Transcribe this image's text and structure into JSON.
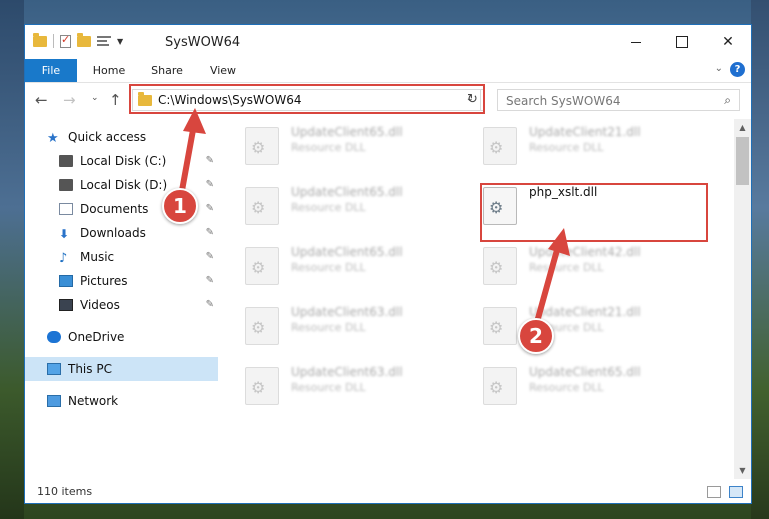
{
  "window": {
    "title": "SysWOW64",
    "minimize_icon": "minimize-icon",
    "maximize_icon": "maximize-icon",
    "close_symbol": "✕"
  },
  "ribbon": {
    "tabs": [
      "File",
      "Home",
      "Share",
      "View"
    ],
    "help_symbol": "?",
    "expand_symbol": "⌄"
  },
  "nav": {
    "back_symbol": "←",
    "forward_symbol": "→",
    "recent_symbol": "⌄",
    "up_symbol": "↑",
    "address": "C:\\Windows\\SysWOW64",
    "address_drop": "⌄",
    "refresh_symbol": "↻",
    "search_placeholder": "Search SysWOW64",
    "search_symbol": "⌕"
  },
  "sidebar": {
    "items": [
      {
        "label": "Quick access",
        "icon": "star-icon",
        "pinned": false
      },
      {
        "label": "Local Disk (C:)",
        "icon": "disk-icon",
        "pinned": true
      },
      {
        "label": "Local Disk (D:)",
        "icon": "disk-icon",
        "pinned": true
      },
      {
        "label": "Documents",
        "icon": "documents-icon",
        "pinned": true
      },
      {
        "label": "Downloads",
        "icon": "download-icon",
        "pinned": true
      },
      {
        "label": "Music",
        "icon": "music-icon",
        "pinned": true
      },
      {
        "label": "Pictures",
        "icon": "pictures-icon",
        "pinned": true
      },
      {
        "label": "Videos",
        "icon": "videos-icon",
        "pinned": true
      },
      {
        "label": "OneDrive",
        "icon": "cloud-icon",
        "pinned": false
      },
      {
        "label": "This PC",
        "icon": "computer-icon",
        "pinned": false,
        "selected": true
      },
      {
        "label": "Network",
        "icon": "network-icon",
        "pinned": false
      }
    ],
    "pin_symbol": "📌"
  },
  "files": [
    {
      "name": "UpdateClient65.dll",
      "type": "Resource DLL",
      "blurred": true
    },
    {
      "name": "UpdateClient21.dll",
      "type": "Resource DLL",
      "blurred": true
    },
    {
      "name": "UpdateClient65.dll",
      "type": "Resource DLL",
      "blurred": true
    },
    {
      "name": "php_xslt.dll",
      "type": "",
      "blurred": false
    },
    {
      "name": "UpdateClient65.dll",
      "type": "Resource DLL",
      "blurred": true
    },
    {
      "name": "UpdateClient42.dll",
      "type": "Resource DLL",
      "blurred": true
    },
    {
      "name": "UpdateClient63.dll",
      "type": "Resource DLL",
      "blurred": true
    },
    {
      "name": "UpdateClient21.dll",
      "type": "Resource DLL",
      "blurred": true
    },
    {
      "name": "UpdateClient63.dll",
      "type": "Resource DLL",
      "blurred": true
    },
    {
      "name": "UpdateClient65.dll",
      "type": "Resource DLL",
      "blurred": true
    }
  ],
  "status": {
    "item_count": "110 items"
  },
  "annotations": {
    "step1": "1",
    "step2": "2",
    "color": "#d8463e"
  }
}
